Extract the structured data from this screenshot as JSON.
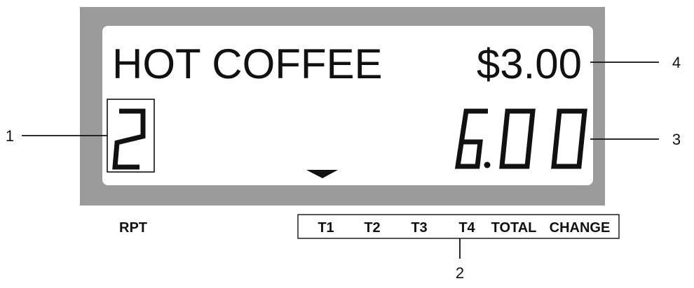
{
  "display": {
    "item_name": "HOT COFFEE",
    "unit_price": "$3.00",
    "quantity": "2",
    "amount": "6.00"
  },
  "indicators": {
    "rpt_label": "RPT",
    "labels": [
      "T1",
      "T2",
      "T3",
      "T4",
      "TOTAL",
      "CHANGE"
    ]
  },
  "callouts": {
    "c1": "1",
    "c2": "2",
    "c3": "3",
    "c4": "4"
  },
  "colors": {
    "bezel": "#9b9b9b",
    "screen": "#ffffff",
    "ink": "#111111"
  },
  "icons": {
    "pointer": "down-triangle-icon"
  }
}
